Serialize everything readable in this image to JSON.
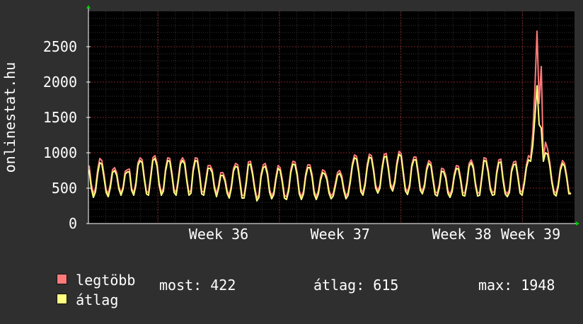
{
  "chart_data": {
    "type": "line",
    "ylabel": "onlinestat.hu",
    "ylim": [
      0,
      3000
    ],
    "yticks": [
      0,
      500,
      1000,
      1500,
      2000,
      2500
    ],
    "x_tick_labels": [
      "Week 36",
      "Week 37",
      "Week 38",
      "Week 39"
    ],
    "grid": true,
    "legend_position": "bottom-left",
    "series": [
      {
        "name": "legtöbb",
        "color": "#ff7a7a",
        "values": [
          820,
          560,
          420,
          500,
          760,
          920,
          890,
          700,
          480,
          420,
          560,
          760,
          790,
          720,
          520,
          430,
          520,
          740,
          760,
          770,
          500,
          430,
          580,
          860,
          930,
          900,
          660,
          450,
          440,
          680,
          930,
          960,
          850,
          580,
          440,
          500,
          780,
          930,
          920,
          720,
          480,
          440,
          640,
          880,
          930,
          880,
          640,
          440,
          470,
          780,
          930,
          920,
          720,
          460,
          440,
          620,
          820,
          820,
          760,
          540,
          420,
          540,
          720,
          720,
          640,
          470,
          400,
          540,
          780,
          850,
          830,
          630,
          400,
          400,
          600,
          870,
          880,
          730,
          520,
          360,
          410,
          700,
          830,
          850,
          730,
          480,
          390,
          450,
          660,
          820,
          790,
          620,
          400,
          380,
          500,
          760,
          880,
          870,
          720,
          460,
          380,
          460,
          700,
          830,
          830,
          700,
          460,
          380,
          460,
          650,
          760,
          740,
          660,
          470,
          390,
          430,
          570,
          720,
          750,
          680,
          500,
          390,
          440,
          620,
          850,
          970,
          950,
          760,
          490,
          440,
          580,
          830,
          980,
          960,
          780,
          540,
          470,
          540,
          800,
          980,
          990,
          800,
          560,
          500,
          620,
          870,
          1020,
          990,
          740,
          500,
          450,
          560,
          840,
          940,
          940,
          740,
          510,
          460,
          560,
          790,
          890,
          860,
          650,
          450,
          430,
          550,
          780,
          770,
          680,
          470,
          410,
          490,
          700,
          820,
          810,
          650,
          440,
          430,
          600,
          850,
          900,
          820,
          580,
          430,
          440,
          680,
          930,
          920,
          760,
          520,
          440,
          450,
          740,
          900,
          910,
          650,
          460,
          420,
          480,
          770,
          870,
          880,
          690,
          470,
          440,
          600,
          830,
          960,
          930,
          1280,
          1900,
          2720,
          1700,
          2220,
          900,
          1150,
          1050,
          870,
          620,
          460,
          430,
          560,
          790,
          890,
          850,
          680,
          450,
          420
        ]
      },
      {
        "name": "átlag",
        "color": "#ffff80",
        "values": [
          760,
          500,
          370,
          450,
          700,
          860,
          840,
          650,
          440,
          380,
          510,
          720,
          750,
          680,
          490,
          400,
          490,
          700,
          730,
          730,
          470,
          400,
          540,
          820,
          890,
          860,
          620,
          420,
          400,
          640,
          890,
          920,
          810,
          540,
          400,
          460,
          740,
          890,
          880,
          680,
          440,
          400,
          600,
          840,
          890,
          840,
          600,
          400,
          430,
          740,
          890,
          880,
          680,
          420,
          400,
          580,
          780,
          780,
          720,
          500,
          380,
          500,
          680,
          680,
          600,
          430,
          360,
          500,
          740,
          810,
          790,
          590,
          360,
          360,
          560,
          830,
          840,
          690,
          480,
          320,
          370,
          660,
          790,
          810,
          690,
          440,
          350,
          410,
          620,
          780,
          750,
          580,
          360,
          340,
          460,
          720,
          840,
          830,
          680,
          420,
          340,
          420,
          660,
          790,
          790,
          660,
          420,
          340,
          420,
          610,
          720,
          700,
          620,
          430,
          350,
          390,
          530,
          680,
          710,
          640,
          460,
          350,
          400,
          580,
          810,
          930,
          910,
          720,
          450,
          400,
          540,
          790,
          940,
          920,
          740,
          500,
          430,
          500,
          760,
          940,
          950,
          760,
          520,
          460,
          580,
          830,
          980,
          950,
          700,
          460,
          410,
          520,
          800,
          900,
          900,
          700,
          470,
          420,
          520,
          750,
          850,
          820,
          610,
          410,
          390,
          510,
          740,
          730,
          640,
          430,
          370,
          450,
          660,
          780,
          770,
          610,
          400,
          390,
          560,
          810,
          860,
          780,
          540,
          390,
          400,
          640,
          890,
          880,
          720,
          480,
          400,
          410,
          700,
          860,
          870,
          610,
          420,
          380,
          440,
          730,
          830,
          840,
          650,
          430,
          400,
          560,
          790,
          900,
          880,
          1100,
          1500,
          1948,
          1400,
          1350,
          880,
          1000,
          980,
          820,
          580,
          420,
          390,
          520,
          750,
          850,
          810,
          640,
          420,
          422
        ],
        "most": "most: 422",
        "atlag": "átlag: 615",
        "max": "max: 1948"
      }
    ]
  }
}
